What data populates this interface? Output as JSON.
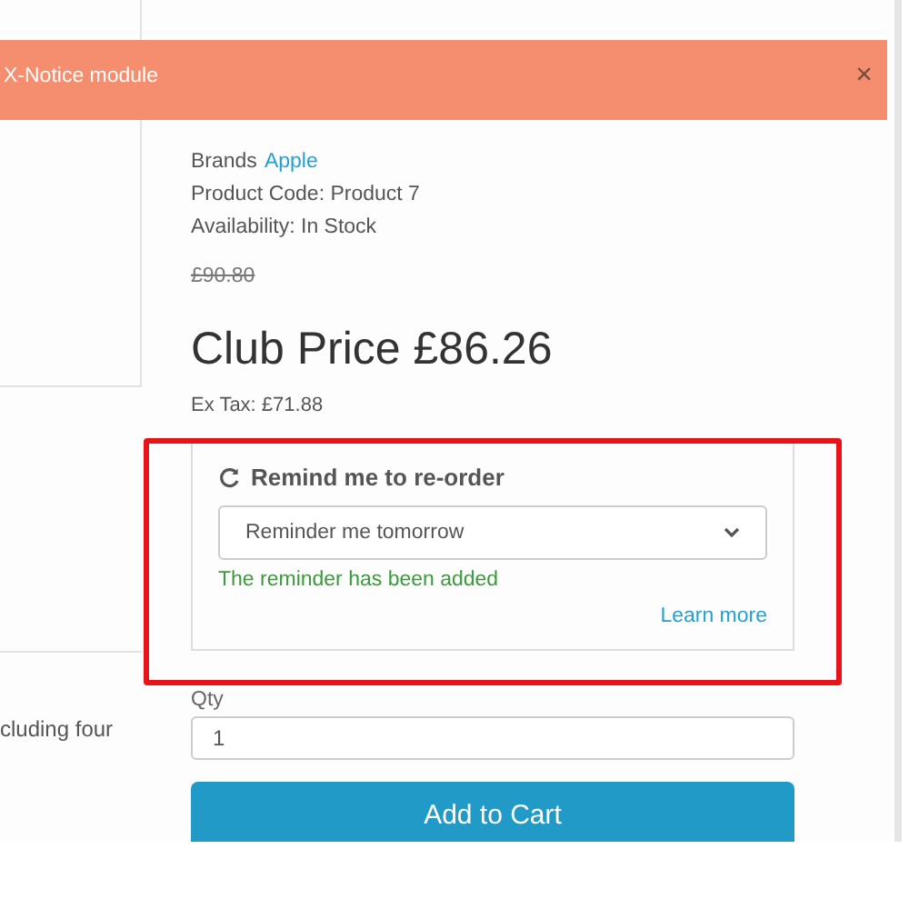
{
  "banner": {
    "text": "X-Notice module",
    "close": "×"
  },
  "product": {
    "brand_label": "Brands",
    "brand": "Apple",
    "code": "Product Code: Product 7",
    "availability": "Availability: In Stock",
    "old_price": "£90.80",
    "price": "Club Price £86.26",
    "ex_tax": "Ex Tax: £71.88"
  },
  "reminder": {
    "title": "Remind me to re-order",
    "option": "Reminder me tomorrow",
    "message": "The reminder has been added",
    "link": "Learn more"
  },
  "description_fragment": "cluding four",
  "quantity": {
    "label": "Qty",
    "value": "1"
  },
  "add_button": "Add to Cart"
}
